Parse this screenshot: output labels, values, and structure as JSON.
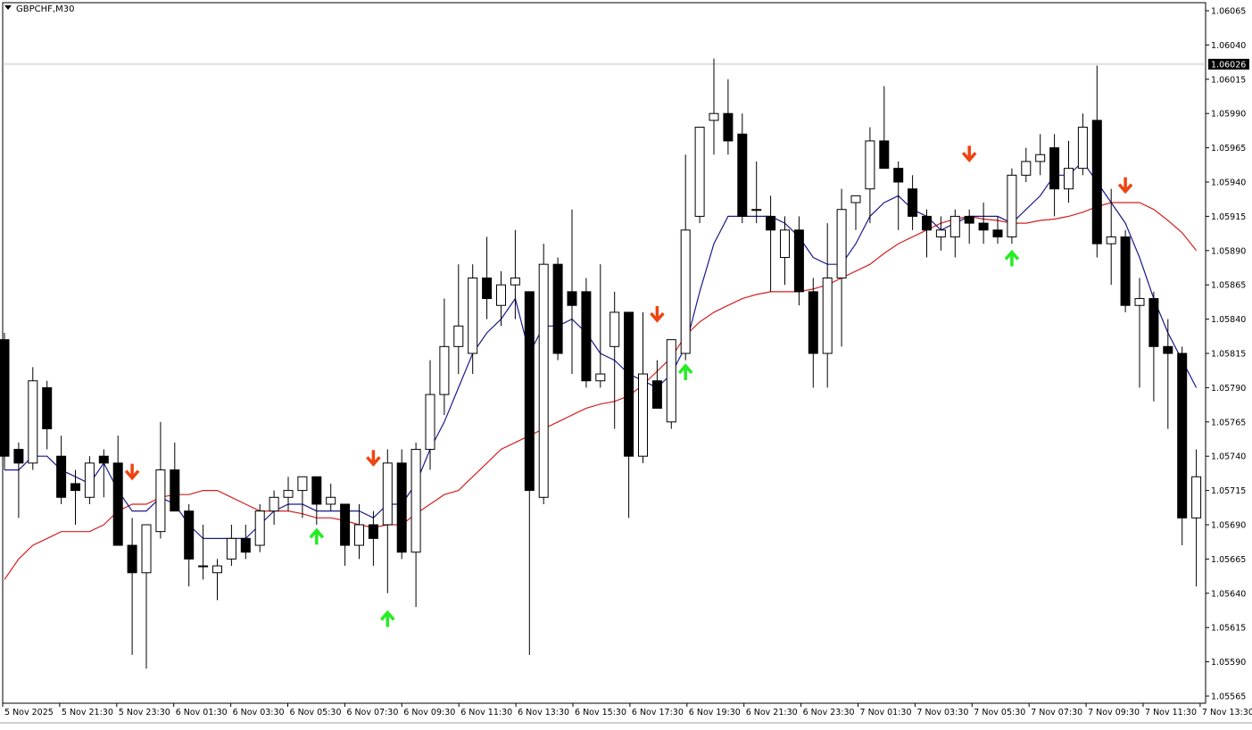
{
  "symbol_title": "GBPCHF,M30",
  "current_price_label": "1.06026",
  "colors": {
    "background": "#ffffff",
    "axis": "#000000",
    "bull_body": "#ffffff",
    "bear_body": "#000000",
    "fast_ma": "#1a1a8c",
    "slow_ma": "#d42020",
    "buy_arrow": "#22ee22",
    "sell_arrow": "#ee4411",
    "price_line": "#c0c0c0"
  },
  "chart_data": {
    "type": "candlestick",
    "symbol": "GBPCHF",
    "timeframe": "M30",
    "ylim": [
      1.0556,
      1.06075
    ],
    "y_ticks": [
      "1.06065",
      "1.06040",
      "1.06015",
      "1.05990",
      "1.05965",
      "1.05940",
      "1.05915",
      "1.05890",
      "1.05865",
      "1.05840",
      "1.05815",
      "1.05790",
      "1.05765",
      "1.05740",
      "1.05715",
      "1.05690",
      "1.05665",
      "1.05640",
      "1.05615",
      "1.05590",
      "1.05565"
    ],
    "x_labels": [
      "5 Nov 2025",
      "5 Nov 21:30",
      "5 Nov 23:30",
      "6 Nov 01:30",
      "6 Nov 03:30",
      "6 Nov 05:30",
      "6 Nov 07:30",
      "6 Nov 09:30",
      "6 Nov 11:30",
      "6 Nov 13:30",
      "6 Nov 15:30",
      "6 Nov 17:30",
      "6 Nov 19:30",
      "6 Nov 21:30",
      "6 Nov 23:30",
      "7 Nov 01:30",
      "7 Nov 03:30",
      "7 Nov 05:30",
      "7 Nov 07:30",
      "7 Nov 09:30",
      "7 Nov 11:30",
      "7 Nov 13:30"
    ],
    "current_price": 1.06026,
    "candles": [
      {
        "o": 1.05825,
        "h": 1.0583,
        "l": 1.0573,
        "c": 1.0574
      },
      {
        "o": 1.05745,
        "h": 1.0575,
        "l": 1.05695,
        "c": 1.05735
      },
      {
        "o": 1.05735,
        "h": 1.05805,
        "l": 1.0573,
        "c": 1.05795
      },
      {
        "o": 1.0579,
        "h": 1.05795,
        "l": 1.05745,
        "c": 1.0576
      },
      {
        "o": 1.0574,
        "h": 1.05755,
        "l": 1.05705,
        "c": 1.0571
      },
      {
        "o": 1.0572,
        "h": 1.0573,
        "l": 1.0569,
        "c": 1.05715
      },
      {
        "o": 1.0571,
        "h": 1.0574,
        "l": 1.05705,
        "c": 1.05735
      },
      {
        "o": 1.0574,
        "h": 1.05745,
        "l": 1.0571,
        "c": 1.05735
      },
      {
        "o": 1.05735,
        "h": 1.05755,
        "l": 1.05695,
        "c": 1.05675
      },
      {
        "o": 1.05675,
        "h": 1.05695,
        "l": 1.05595,
        "c": 1.05655
      },
      {
        "o": 1.05655,
        "h": 1.0569,
        "l": 1.05585,
        "c": 1.0569
      },
      {
        "o": 1.05685,
        "h": 1.05765,
        "l": 1.0568,
        "c": 1.0573
      },
      {
        "o": 1.0573,
        "h": 1.0575,
        "l": 1.057,
        "c": 1.057
      },
      {
        "o": 1.057,
        "h": 1.05705,
        "l": 1.05645,
        "c": 1.05665
      },
      {
        "o": 1.0566,
        "h": 1.0569,
        "l": 1.0565,
        "c": 1.0566
      },
      {
        "o": 1.05655,
        "h": 1.05665,
        "l": 1.05635,
        "c": 1.0566
      },
      {
        "o": 1.05665,
        "h": 1.0569,
        "l": 1.0566,
        "c": 1.0568
      },
      {
        "o": 1.0568,
        "h": 1.0569,
        "l": 1.05665,
        "c": 1.0567
      },
      {
        "o": 1.05675,
        "h": 1.05705,
        "l": 1.0567,
        "c": 1.057
      },
      {
        "o": 1.057,
        "h": 1.05715,
        "l": 1.0569,
        "c": 1.0571
      },
      {
        "o": 1.0571,
        "h": 1.05725,
        "l": 1.057,
        "c": 1.05715
      },
      {
        "o": 1.05715,
        "h": 1.0572,
        "l": 1.05695,
        "c": 1.05725
      },
      {
        "o": 1.05725,
        "h": 1.05725,
        "l": 1.0569,
        "c": 1.05705
      },
      {
        "o": 1.05705,
        "h": 1.0572,
        "l": 1.057,
        "c": 1.0571
      },
      {
        "o": 1.05705,
        "h": 1.05705,
        "l": 1.0566,
        "c": 1.05675
      },
      {
        "o": 1.05675,
        "h": 1.05705,
        "l": 1.05665,
        "c": 1.0569
      },
      {
        "o": 1.0569,
        "h": 1.057,
        "l": 1.0566,
        "c": 1.0568
      },
      {
        "o": 1.0569,
        "h": 1.05745,
        "l": 1.0564,
        "c": 1.05735
      },
      {
        "o": 1.05735,
        "h": 1.05745,
        "l": 1.05665,
        "c": 1.0567
      },
      {
        "o": 1.0567,
        "h": 1.0575,
        "l": 1.0563,
        "c": 1.05745
      },
      {
        "o": 1.05745,
        "h": 1.0581,
        "l": 1.0573,
        "c": 1.05785
      },
      {
        "o": 1.05785,
        "h": 1.05855,
        "l": 1.0577,
        "c": 1.0582
      },
      {
        "o": 1.0582,
        "h": 1.0588,
        "l": 1.058,
        "c": 1.05835
      },
      {
        "o": 1.05815,
        "h": 1.0588,
        "l": 1.058,
        "c": 1.0587
      },
      {
        "o": 1.0587,
        "h": 1.059,
        "l": 1.0584,
        "c": 1.05855
      },
      {
        "o": 1.0585,
        "h": 1.05875,
        "l": 1.05835,
        "c": 1.05865
      },
      {
        "o": 1.05865,
        "h": 1.05905,
        "l": 1.0584,
        "c": 1.0587
      },
      {
        "o": 1.0586,
        "h": 1.0586,
        "l": 1.05595,
        "c": 1.05715
      },
      {
        "o": 1.0571,
        "h": 1.05895,
        "l": 1.05705,
        "c": 1.0588
      },
      {
        "o": 1.0588,
        "h": 1.05885,
        "l": 1.0581,
        "c": 1.05815
      },
      {
        "o": 1.0586,
        "h": 1.0592,
        "l": 1.058,
        "c": 1.0585
      },
      {
        "o": 1.0586,
        "h": 1.0587,
        "l": 1.0579,
        "c": 1.05795
      },
      {
        "o": 1.05795,
        "h": 1.0588,
        "l": 1.0579,
        "c": 1.058
      },
      {
        "o": 1.0582,
        "h": 1.0586,
        "l": 1.0576,
        "c": 1.05845
      },
      {
        "o": 1.05845,
        "h": 1.05845,
        "l": 1.05695,
        "c": 1.0574
      },
      {
        "o": 1.0574,
        "h": 1.05845,
        "l": 1.05735,
        "c": 1.058
      },
      {
        "o": 1.05795,
        "h": 1.0581,
        "l": 1.05775,
        "c": 1.05775
      },
      {
        "o": 1.05765,
        "h": 1.05825,
        "l": 1.0576,
        "c": 1.05825
      },
      {
        "o": 1.05815,
        "h": 1.0596,
        "l": 1.0581,
        "c": 1.05905
      },
      {
        "o": 1.05915,
        "h": 1.0598,
        "l": 1.0591,
        "c": 1.0598
      },
      {
        "o": 1.05985,
        "h": 1.0603,
        "l": 1.0596,
        "c": 1.0599
      },
      {
        "o": 1.0599,
        "h": 1.06015,
        "l": 1.0596,
        "c": 1.0597
      },
      {
        "o": 1.05975,
        "h": 1.0599,
        "l": 1.0591,
        "c": 1.05915
      },
      {
        "o": 1.0592,
        "h": 1.05955,
        "l": 1.0591,
        "c": 1.0592
      },
      {
        "o": 1.05915,
        "h": 1.0593,
        "l": 1.0586,
        "c": 1.05905
      },
      {
        "o": 1.05885,
        "h": 1.05915,
        "l": 1.05865,
        "c": 1.05905
      },
      {
        "o": 1.05905,
        "h": 1.05915,
        "l": 1.0585,
        "c": 1.0586
      },
      {
        "o": 1.0586,
        "h": 1.0587,
        "l": 1.0579,
        "c": 1.05815
      },
      {
        "o": 1.05815,
        "h": 1.0591,
        "l": 1.0579,
        "c": 1.0587
      },
      {
        "o": 1.0587,
        "h": 1.05935,
        "l": 1.0582,
        "c": 1.0592
      },
      {
        "o": 1.05925,
        "h": 1.0593,
        "l": 1.05905,
        "c": 1.0593
      },
      {
        "o": 1.05935,
        "h": 1.0598,
        "l": 1.0591,
        "c": 1.0597
      },
      {
        "o": 1.0597,
        "h": 1.0601,
        "l": 1.0595,
        "c": 1.0595
      },
      {
        "o": 1.0595,
        "h": 1.05955,
        "l": 1.05905,
        "c": 1.0594
      },
      {
        "o": 1.05935,
        "h": 1.05945,
        "l": 1.05905,
        "c": 1.05915
      },
      {
        "o": 1.05915,
        "h": 1.0592,
        "l": 1.05885,
        "c": 1.05905
      },
      {
        "o": 1.059,
        "h": 1.05915,
        "l": 1.0589,
        "c": 1.05905
      },
      {
        "o": 1.059,
        "h": 1.0592,
        "l": 1.05885,
        "c": 1.05915
      },
      {
        "o": 1.05915,
        "h": 1.0592,
        "l": 1.05895,
        "c": 1.0591
      },
      {
        "o": 1.0591,
        "h": 1.05925,
        "l": 1.05895,
        "c": 1.05905
      },
      {
        "o": 1.05905,
        "h": 1.05915,
        "l": 1.05895,
        "c": 1.059
      },
      {
        "o": 1.059,
        "h": 1.0595,
        "l": 1.05895,
        "c": 1.05945
      },
      {
        "o": 1.05945,
        "h": 1.05965,
        "l": 1.0594,
        "c": 1.05955
      },
      {
        "o": 1.05955,
        "h": 1.05975,
        "l": 1.05945,
        "c": 1.0596
      },
      {
        "o": 1.05965,
        "h": 1.05975,
        "l": 1.05915,
        "c": 1.05935
      },
      {
        "o": 1.05935,
        "h": 1.0597,
        "l": 1.05925,
        "c": 1.0595
      },
      {
        "o": 1.0595,
        "h": 1.0599,
        "l": 1.05945,
        "c": 1.0598
      },
      {
        "o": 1.05985,
        "h": 1.06025,
        "l": 1.05885,
        "c": 1.05895
      },
      {
        "o": 1.05895,
        "h": 1.05935,
        "l": 1.05865,
        "c": 1.059
      },
      {
        "o": 1.059,
        "h": 1.05905,
        "l": 1.05845,
        "c": 1.0585
      },
      {
        "o": 1.0585,
        "h": 1.0587,
        "l": 1.0579,
        "c": 1.05855
      },
      {
        "o": 1.05855,
        "h": 1.0586,
        "l": 1.0578,
        "c": 1.0582
      },
      {
        "o": 1.0582,
        "h": 1.0584,
        "l": 1.0576,
        "c": 1.05815
      },
      {
        "o": 1.05815,
        "h": 1.0582,
        "l": 1.05675,
        "c": 1.05695
      },
      {
        "o": 1.05695,
        "h": 1.05745,
        "l": 1.05645,
        "c": 1.05725
      }
    ],
    "series": [
      {
        "values": [
          1.0573,
          1.0573,
          1.0574,
          1.0574,
          1.0573,
          1.05725,
          1.0572,
          1.05735,
          1.05715,
          1.057,
          1.057,
          1.0571,
          1.05705,
          1.0569,
          1.0568,
          1.0568,
          1.0568,
          1.0568,
          1.0569,
          1.057,
          1.05705,
          1.05705,
          1.057,
          1.057,
          1.057,
          1.057,
          1.05695,
          1.05705,
          1.05705,
          1.0572,
          1.05745,
          1.05765,
          1.0579,
          1.05815,
          1.0583,
          1.0584,
          1.05855,
          1.05815,
          1.05835,
          1.05835,
          1.0584,
          1.0583,
          1.05815,
          1.0581,
          1.058,
          1.05795,
          1.0579,
          1.058,
          1.0582,
          1.0586,
          1.05895,
          1.05915,
          1.05915,
          1.05915,
          1.05915,
          1.0591,
          1.059,
          1.05885,
          1.0588,
          1.0588,
          1.05895,
          1.05915,
          1.05925,
          1.0593,
          1.0592,
          1.05915,
          1.05905,
          1.0591,
          1.05915,
          1.05915,
          1.05915,
          1.0591,
          1.0592,
          1.0593,
          1.05945,
          1.05945,
          1.05955,
          1.0594,
          1.05925,
          1.0591,
          1.05885,
          1.05855,
          1.0583,
          1.0581,
          1.0579
        ]
      },
      {
        "values": [
          1.0565,
          1.05665,
          1.05675,
          1.0568,
          1.05685,
          1.05685,
          1.05685,
          1.0569,
          1.057,
          1.05705,
          1.05705,
          1.0571,
          1.05712,
          1.05712,
          1.05715,
          1.05715,
          1.0571,
          1.05705,
          1.057,
          1.057,
          1.057,
          1.05698,
          1.05695,
          1.05695,
          1.05693,
          1.0569,
          1.05688,
          1.0569,
          1.0569,
          1.05698,
          1.05705,
          1.05712,
          1.05715,
          1.05725,
          1.05735,
          1.05745,
          1.0575,
          1.05755,
          1.0576,
          1.05765,
          1.0577,
          1.05775,
          1.05778,
          1.0578,
          1.05784,
          1.05792,
          1.05802,
          1.05812,
          1.05828,
          1.05838,
          1.05845,
          1.0585,
          1.05855,
          1.05858,
          1.0586,
          1.0586,
          1.0586,
          1.05862,
          1.05865,
          1.0587,
          1.05875,
          1.0588,
          1.05888,
          1.05895,
          1.059,
          1.05905,
          1.0591,
          1.05913,
          1.05915,
          1.05913,
          1.05912,
          1.0591,
          1.0591,
          1.05912,
          1.05913,
          1.05915,
          1.05918,
          1.05922,
          1.05925,
          1.05925,
          1.05925,
          1.0592,
          1.05912,
          1.05903,
          1.0589
        ]
      }
    ],
    "markers": [
      {
        "index": 9,
        "type": "sell",
        "price": 1.05728
      },
      {
        "index": 22,
        "type": "buy",
        "price": 1.05682
      },
      {
        "index": 26,
        "type": "sell",
        "price": 1.05738
      },
      {
        "index": 27,
        "type": "buy",
        "price": 1.05622
      },
      {
        "index": 46,
        "type": "sell",
        "price": 1.05843
      },
      {
        "index": 48,
        "type": "buy",
        "price": 1.05802
      },
      {
        "index": 68,
        "type": "sell",
        "price": 1.0596
      },
      {
        "index": 71,
        "type": "buy",
        "price": 1.05885
      },
      {
        "index": 79,
        "type": "sell",
        "price": 1.05937
      }
    ]
  }
}
